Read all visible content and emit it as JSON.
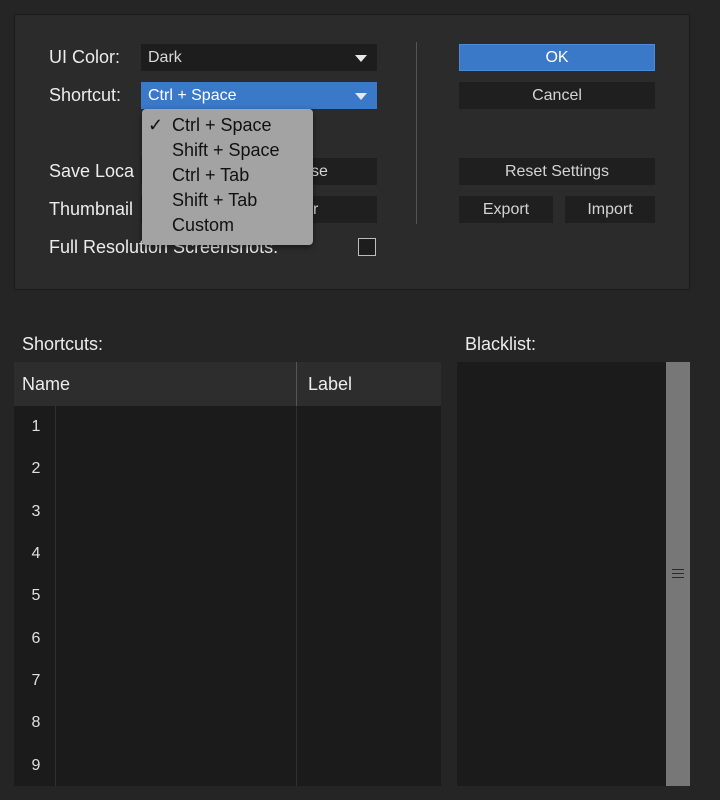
{
  "settings": {
    "ui_color_label": "UI Color:",
    "ui_color_value": "Dark",
    "shortcut_label": "Shortcut:",
    "shortcut_value": "Ctrl + Space",
    "save_location_label": "Save Loca",
    "save_location_button": "se",
    "thumbnail_label": "Thumbnail",
    "thumbnail_button": "r",
    "full_res_label": "Full Resolution Screenshots:"
  },
  "buttons": {
    "ok": "OK",
    "cancel": "Cancel",
    "reset": "Reset Settings",
    "export": "Export",
    "import": "Import"
  },
  "dropdown": {
    "checkmark": "✓",
    "options": [
      "Ctrl + Space",
      "Shift + Space",
      "Ctrl + Tab",
      "Shift + Tab",
      "Custom"
    ],
    "selected_index": 0
  },
  "shortcuts": {
    "title": "Shortcuts:",
    "columns": [
      "Name",
      "Label"
    ],
    "row_numbers": [
      "1",
      "2",
      "3",
      "4",
      "5",
      "6",
      "7",
      "8",
      "9"
    ]
  },
  "blacklist": {
    "title": "Blacklist:"
  },
  "colors": {
    "accent": "#3a78c8",
    "background": "#252525",
    "panel": "#2b2b2b",
    "menu": "#a3a3a3"
  }
}
